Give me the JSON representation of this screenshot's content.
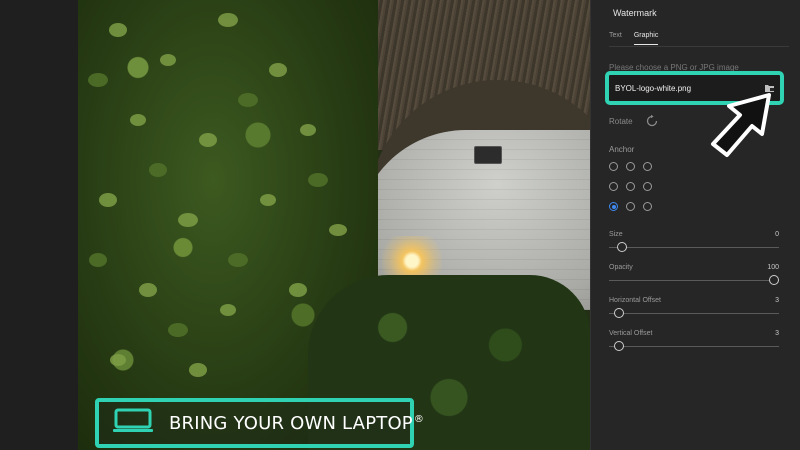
{
  "panel": {
    "title": "Watermark",
    "tabs": [
      {
        "label": "Text",
        "active": false
      },
      {
        "label": "Graphic",
        "active": true
      }
    ],
    "hint": "Please choose a PNG or JPG image",
    "file": {
      "value": "BYOL-logo-white.png",
      "browse_icon": "folder-browse-icon"
    },
    "rotate": {
      "label": "Rotate",
      "icon": "rotate-icon"
    },
    "anchor": {
      "label": "Anchor",
      "selected": "bottom-left"
    },
    "sliders": [
      {
        "id": "size",
        "label": "Size",
        "value": "0",
        "level": 0.05
      },
      {
        "id": "opacity",
        "label": "Opacity",
        "value": "100",
        "level": 1.0
      },
      {
        "id": "horizontal-offset",
        "label": "Horizontal Offset",
        "value": "3",
        "level": 0.03
      },
      {
        "id": "vertical-offset",
        "label": "Vertical Offset",
        "value": "3",
        "level": 0.03
      }
    ]
  },
  "watermark_logo": {
    "text": "BRING YOUR OWN LAPTOP",
    "registered": "®",
    "icon": "laptop-icon"
  },
  "colors": {
    "accent": "#2fd3b3",
    "radio_selected": "#3d8bf2",
    "panel_bg": "#262626"
  }
}
